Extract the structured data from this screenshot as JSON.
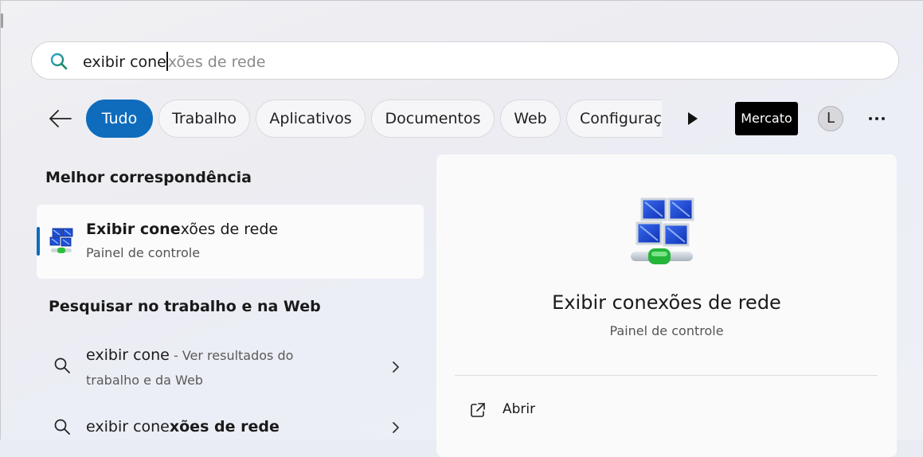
{
  "search": {
    "typed": "exibir cone",
    "suggestion": "xões de rede"
  },
  "filters": {
    "back_icon": "arrow-left-icon",
    "chips": [
      "Tudo",
      "Trabalho",
      "Aplicativos",
      "Documentos",
      "Web",
      "Configuraç"
    ],
    "active_chip": "Tudo",
    "more_chips_icon": "play-icon",
    "brand_label": "Mercato",
    "avatar_initial": "L",
    "more_icon": "ellipsis-icon"
  },
  "best_match": {
    "heading": "Melhor correspondência",
    "title_bold": "Exibir cone",
    "title_rest": "xões de rede",
    "subtitle": "Painel de controle",
    "icon": "network-connections-icon"
  },
  "web_search": {
    "heading": "Pesquisar no trabalho e na Web",
    "items": [
      {
        "query": "exibir cone",
        "suffix": " - Ver resultados do trabalho e da Web"
      },
      {
        "query_plain": "exibir cone",
        "query_bold": "xões de rede"
      }
    ]
  },
  "preview": {
    "title": "Exibir conexões de rede",
    "subtitle": "Painel de controle",
    "actions": [
      {
        "label": "Abrir",
        "icon": "open-external-icon"
      }
    ]
  },
  "colors": {
    "accent": "#0f6cbd",
    "brand_bg": "#000000"
  }
}
